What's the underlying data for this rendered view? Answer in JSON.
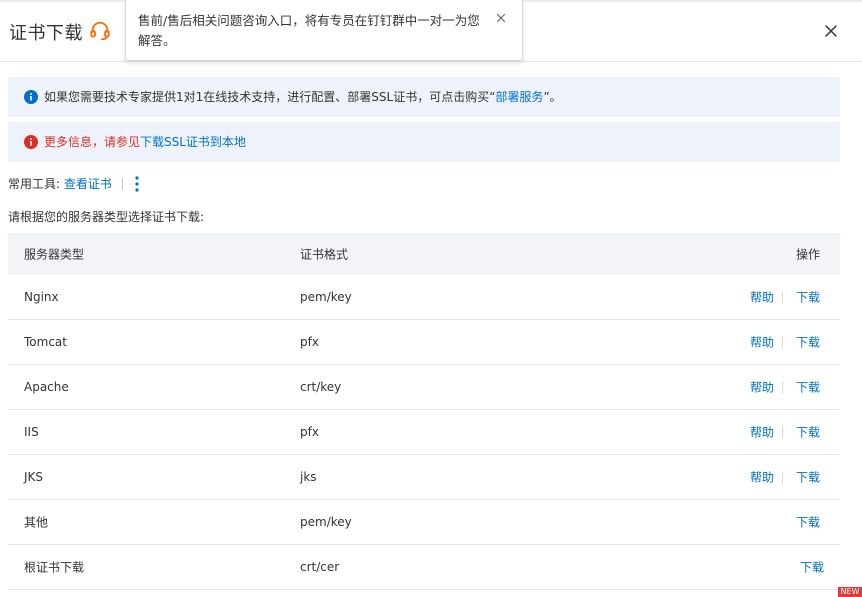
{
  "header": {
    "title": "证书下载"
  },
  "popover": {
    "text": "售前/售后相关问题咨询入口，将有专员在钉钉群中一对一为您解答。"
  },
  "alerts": [
    {
      "prefix": "如果您需要技术专家提供1对1在线技术支持，进行配置、部署SSL证书，可点击购买“",
      "link": "部署服务",
      "suffix": "”。"
    },
    {
      "prefix": "更多信息，请参见",
      "link": "下载SSL证书到本地"
    }
  ],
  "tools": {
    "label": "常用工具:",
    "link": "查看证书"
  },
  "hint": "请根据您的服务器类型选择证书下载:",
  "table": {
    "headers": [
      "服务器类型",
      "证书格式",
      "操作"
    ],
    "help_label": "帮助",
    "download_label": "下载",
    "rows": [
      {
        "server": "Nginx",
        "format": "pem/key"
      },
      {
        "server": "Tomcat",
        "format": "pfx"
      },
      {
        "server": "Apache",
        "format": "crt/key"
      },
      {
        "server": "IIS",
        "format": "pfx"
      },
      {
        "server": "JKS",
        "format": "jks"
      },
      {
        "server": "其他",
        "format": "pem/key"
      },
      {
        "server": "根证书下载",
        "format": "crt/cer"
      }
    ]
  },
  "badge": "NEW",
  "colors": {
    "link": "#0070cc",
    "alert_bg": "#eef3fb",
    "error_text": "#d93026",
    "headset_orange": "#ff6a00"
  }
}
